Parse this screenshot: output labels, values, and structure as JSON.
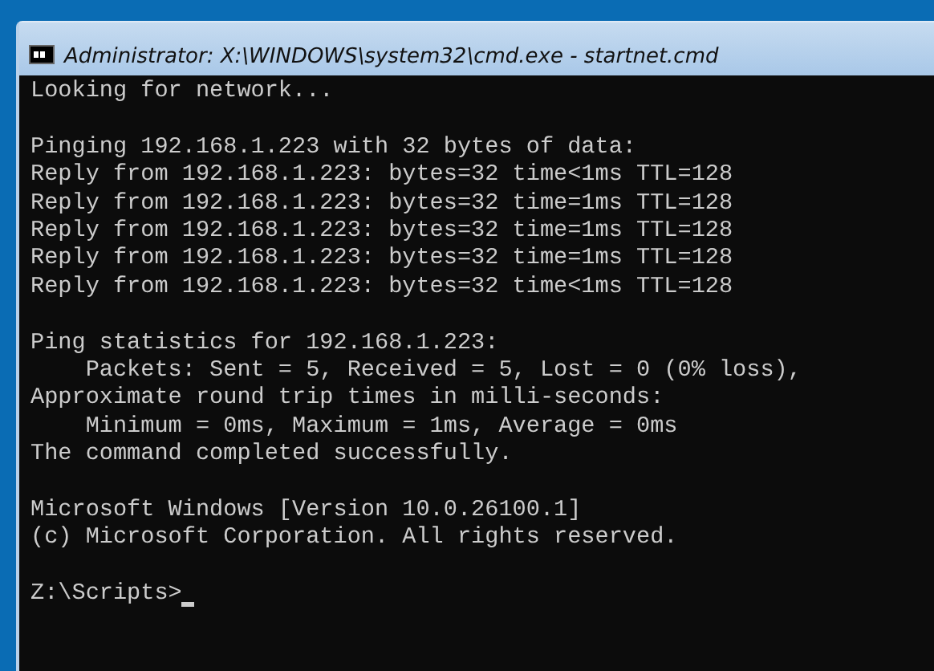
{
  "window": {
    "title": "Administrator: X:\\WINDOWS\\system32\\cmd.exe - startnet.cmd"
  },
  "console": {
    "blocks": [
      [
        "Looking for network..."
      ],
      [
        "Pinging 192.168.1.223 with 32 bytes of data:",
        "Reply from 192.168.1.223: bytes=32 time<1ms TTL=128",
        "Reply from 192.168.1.223: bytes=32 time=1ms TTL=128",
        "Reply from 192.168.1.223: bytes=32 time=1ms TTL=128",
        "Reply from 192.168.1.223: bytes=32 time=1ms TTL=128",
        "Reply from 192.168.1.223: bytes=32 time<1ms TTL=128"
      ],
      [
        "Ping statistics for 192.168.1.223:",
        "    Packets: Sent = 5, Received = 5, Lost = 0 (0% loss),",
        "Approximate round trip times in milli-seconds:",
        "    Minimum = 0ms, Maximum = 1ms, Average = 0ms",
        "The command completed successfully."
      ],
      [
        "Microsoft Windows [Version 10.0.26100.1]",
        "(c) Microsoft Corporation. All rights reserved."
      ]
    ],
    "prompt": "Z:\\Scripts>"
  }
}
